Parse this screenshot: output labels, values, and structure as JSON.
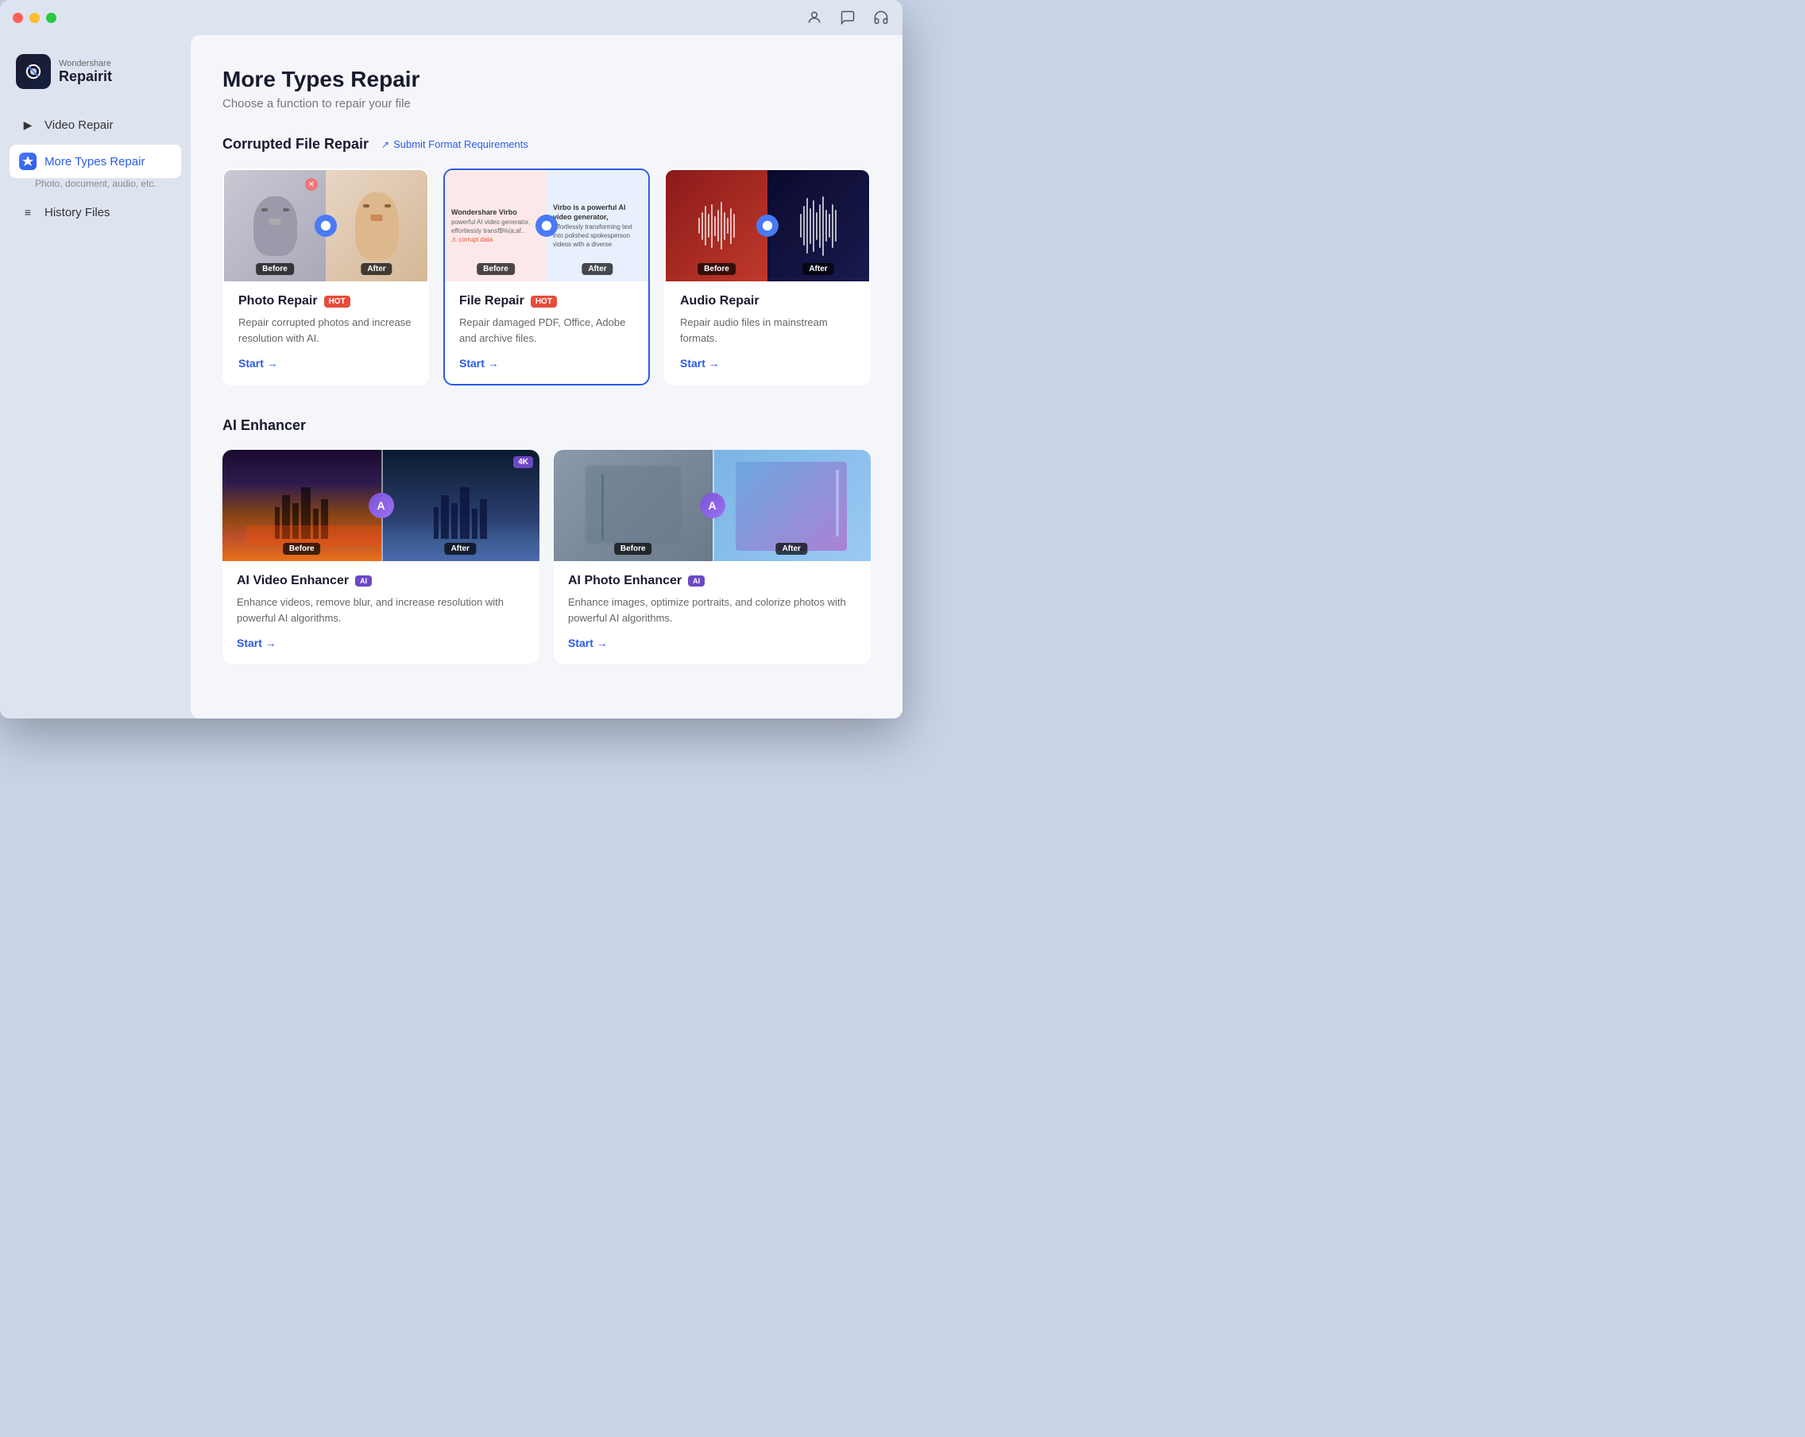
{
  "window": {
    "title": "Wondershare Repairit"
  },
  "titlebar": {
    "icons": [
      "account-icon",
      "chat-icon",
      "headset-icon"
    ]
  },
  "logo": {
    "brand": "Wondershare",
    "name": "Repairit"
  },
  "sidebar": {
    "items": [
      {
        "id": "video-repair",
        "label": "Video Repair",
        "active": false,
        "icon": "▶"
      },
      {
        "id": "more-types-repair",
        "label": "More Types Repair",
        "subtitle": "Photo, document, audio, etc.",
        "active": true,
        "icon": "✦"
      },
      {
        "id": "history-files",
        "label": "History Files",
        "active": false,
        "icon": "≡"
      }
    ]
  },
  "main": {
    "title": "More Types Repair",
    "subtitle": "Choose a function to repair your file",
    "sections": [
      {
        "id": "corrupted-file-repair",
        "title": "Corrupted File Repair",
        "submit_link": "Submit Format Requirements",
        "cards": [
          {
            "id": "photo-repair",
            "title": "Photo Repair",
            "badge": "HOT",
            "badge_color": "#e74c3c",
            "description": "Repair corrupted photos and increase resolution with AI.",
            "start_label": "Start →",
            "selected": false,
            "image_type": "photo"
          },
          {
            "id": "file-repair",
            "title": "File Repair",
            "badge": "HOT",
            "badge_color": "#e74c3c",
            "description": "Repair damaged PDF, Office, Adobe and archive files.",
            "start_label": "Start →",
            "selected": true,
            "image_type": "file"
          },
          {
            "id": "audio-repair",
            "title": "Audio Repair",
            "badge": null,
            "description": "Repair audio files in mainstream formats.",
            "start_label": "Start →",
            "selected": false,
            "image_type": "audio"
          }
        ]
      },
      {
        "id": "ai-enhancer",
        "title": "AI Enhancer",
        "cards": [
          {
            "id": "ai-video-enhancer",
            "title": "AI Video Enhancer",
            "badge": "AI",
            "badge_color": "#6c48c5",
            "description": "Enhance videos, remove blur, and increase resolution with powerful AI algorithms.",
            "start_label": "Start →",
            "image_type": "video-enhance",
            "extra_badge": "4K"
          },
          {
            "id": "ai-photo-enhancer",
            "title": "AI Photo Enhancer",
            "badge": "AI",
            "badge_color": "#6c48c5",
            "description": "Enhance images, optimize portraits, and colorize photos with powerful AI algorithms.",
            "start_label": "Start →",
            "image_type": "photo-enhance"
          }
        ]
      }
    ]
  }
}
